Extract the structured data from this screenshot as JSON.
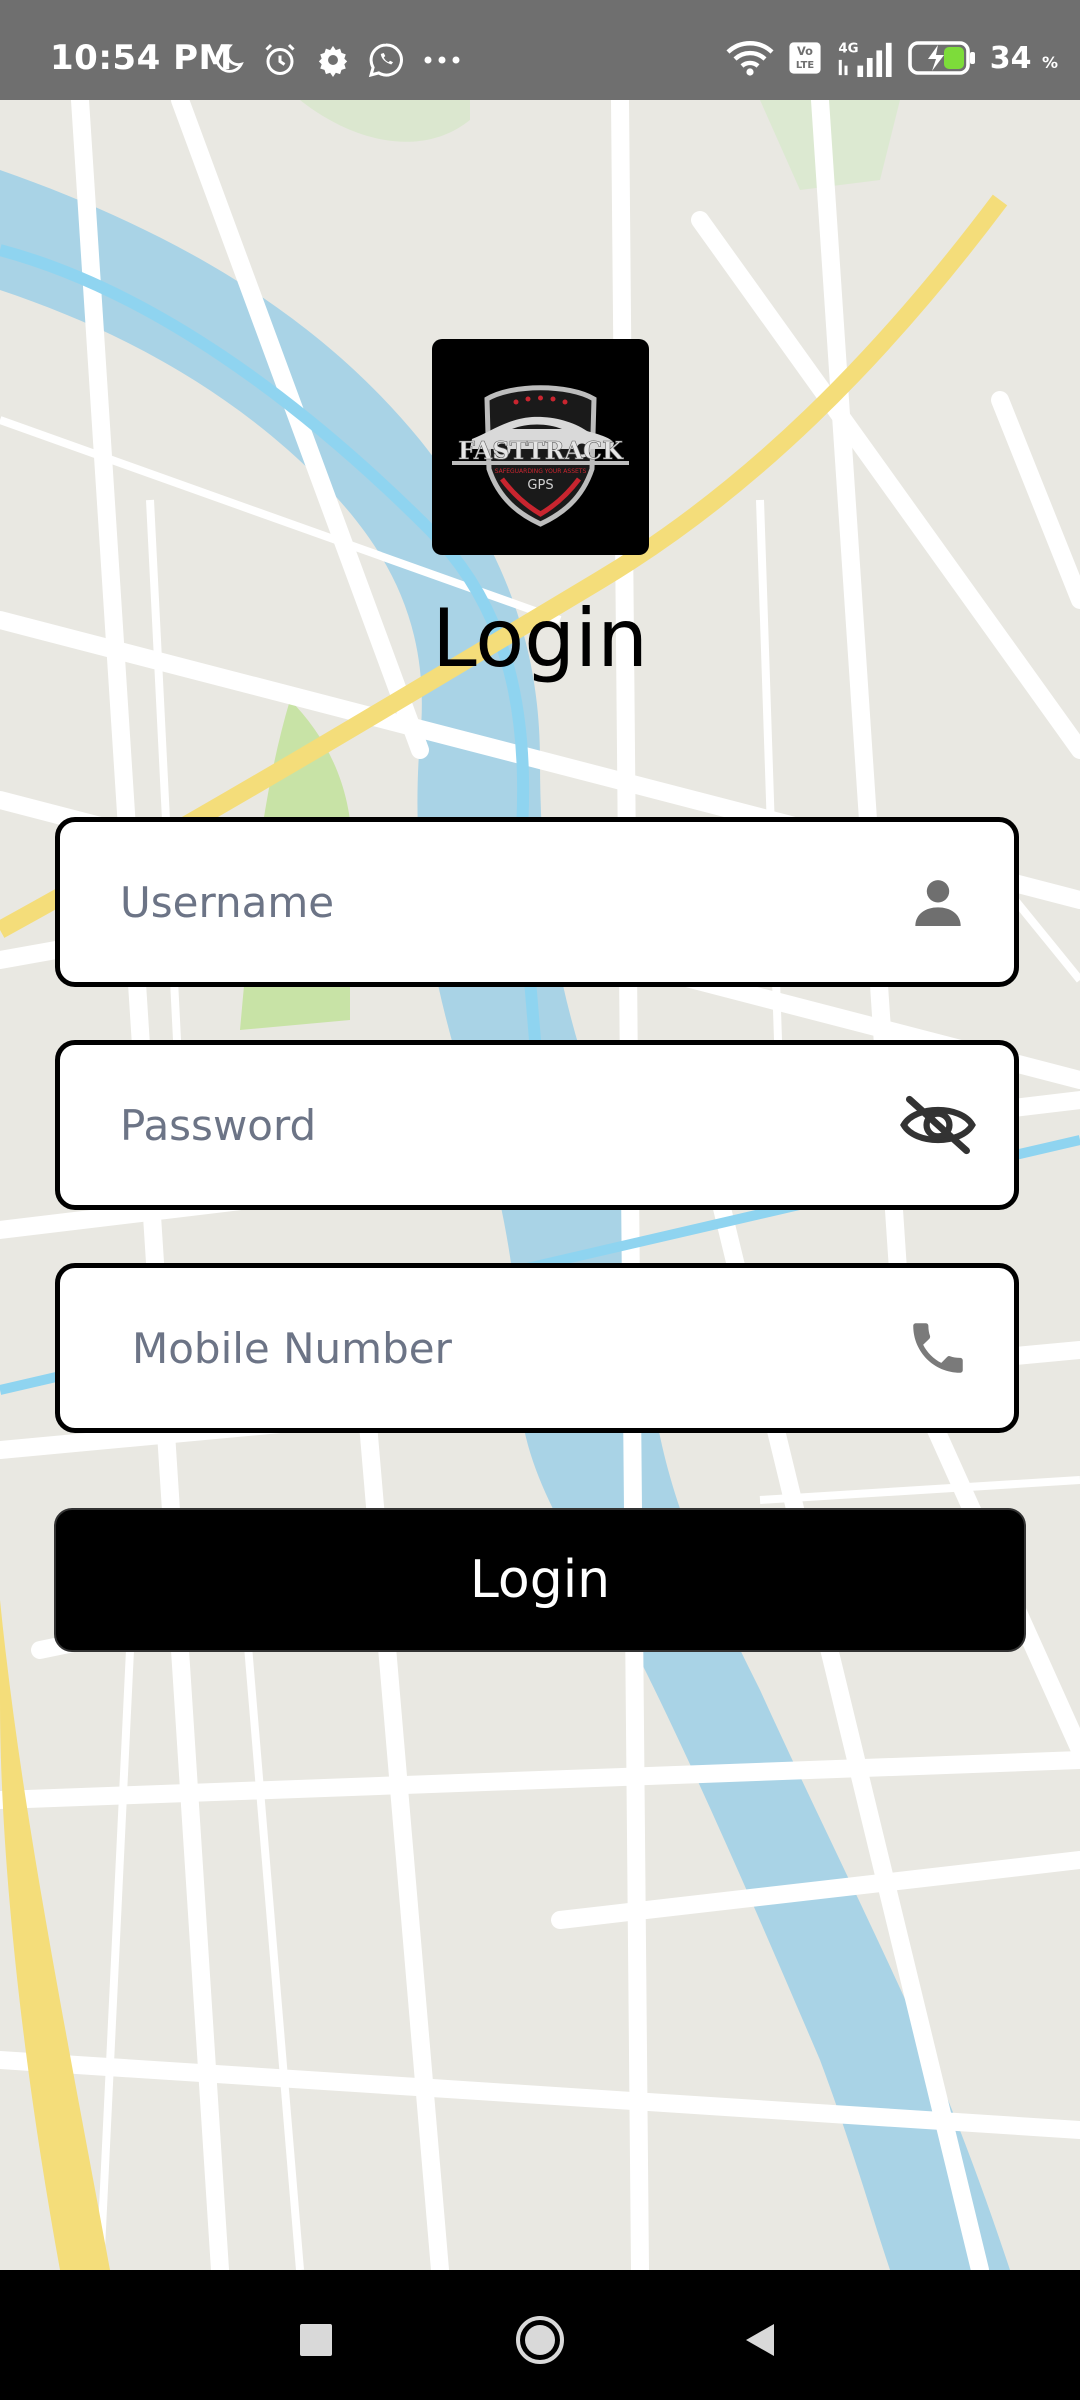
{
  "status_bar": {
    "time": "10:54 PM",
    "battery_percent": "34",
    "battery_unit": "%",
    "network": "4G",
    "volte": "Vo LTE",
    "left_icons": [
      "moon-icon",
      "alarm-icon",
      "settings-gear-icon",
      "whatsapp-icon",
      "more-dots-icon"
    ],
    "right_icons": [
      "wifi-icon",
      "volte-icon",
      "signal-icon",
      "battery-charging-icon"
    ]
  },
  "logo": {
    "brand": "FASTTRACK",
    "tagline": "SAFEGUARDING YOUR ASSETS",
    "sub": "GPS"
  },
  "title": "Login",
  "form": {
    "username_placeholder": "Username",
    "password_placeholder": "Password",
    "mobile_placeholder": "Mobile Number",
    "username_icon": "person-icon",
    "password_icon": "eye-off-icon",
    "mobile_icon": "phone-icon"
  },
  "login_button_label": "Login",
  "colors": {
    "status_bar": "#6f6f6f",
    "button_bg": "#000000",
    "button_text": "#ffffff",
    "placeholder": "#6c7486",
    "battery_accent": "#7ddc3a",
    "map_water": "#a9d3e6",
    "map_road_major": "#f4dd7a",
    "map_park": "#c8e3a6"
  }
}
